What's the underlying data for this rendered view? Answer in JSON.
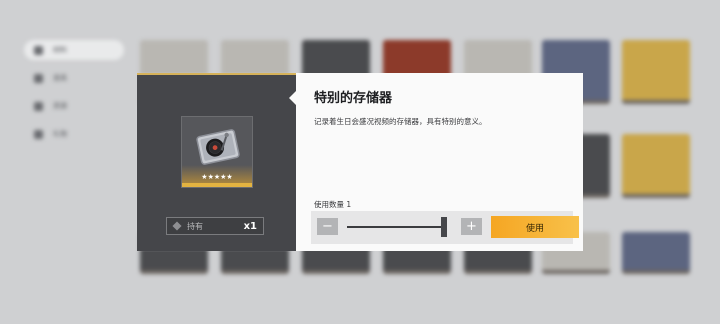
{
  "sidebar": {
    "items": [
      {
        "label": "材料",
        "icon": "materials-icon",
        "active": true
      },
      {
        "label": "道具",
        "icon": "items-icon",
        "active": false
      },
      {
        "label": "资源",
        "icon": "resources-icon",
        "active": false
      },
      {
        "label": "礼物",
        "icon": "gift-icon",
        "active": false
      }
    ]
  },
  "modal": {
    "title": "特别的存储器",
    "description": "记录着生日会盛况视频的存储器，具有特别的意义。",
    "item": {
      "icon": "record-player-icon",
      "stars": "★★★★★",
      "rarity": 5
    },
    "own": {
      "label": "持有",
      "count": "x1"
    },
    "quantity": {
      "label": "使用数量 1",
      "value": 1,
      "minus": "−",
      "plus": "+"
    },
    "use_button": "使用",
    "colors": {
      "accent": "#f5a623",
      "rarity_gold": "#e3b341",
      "panel_dark": "#45464a"
    }
  }
}
